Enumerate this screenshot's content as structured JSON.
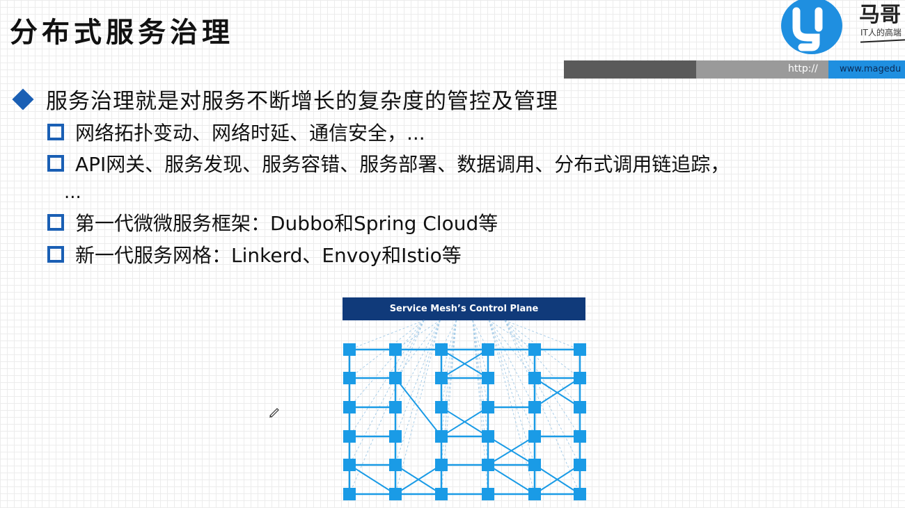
{
  "slide": {
    "title": "分布式服务治理",
    "logo": {
      "brand": "马哥",
      "slogan": "IT人的高端",
      "icon": "logo-icon"
    },
    "url_bar": {
      "http": "http://",
      "www": "www.magedu"
    },
    "main_point": "服务治理就是对服务不断增长的复杂度的管控及管理",
    "sub_points": [
      "网络拓扑变动、网络时延、通信安全，...",
      "API网关、服务发现、服务容错、服务部署、数据调用、分布式调用链追踪，",
      "第一代微微服务框架：Dubbo和Spring Cloud等",
      "新一代服务网格：Linkerd、Envoy和Istio等"
    ],
    "sub_point_continuation": "...",
    "diagram": {
      "header": "Service Mesh’s Control Plane",
      "node_color": "#1a9be6",
      "line_color": "#1a9be6",
      "dashed_color": "#a8cde8",
      "header_color": "#103a7a"
    }
  }
}
